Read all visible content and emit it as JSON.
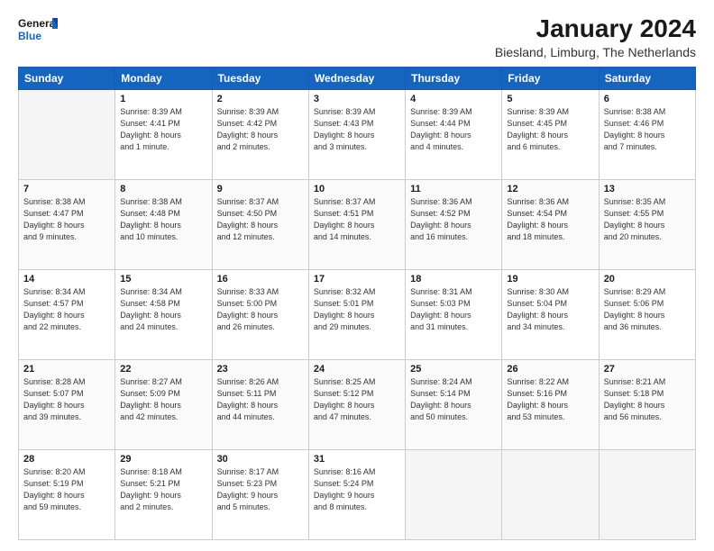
{
  "header": {
    "logo_general": "General",
    "logo_blue": "Blue",
    "month": "January 2024",
    "location": "Biesland, Limburg, The Netherlands"
  },
  "weekdays": [
    "Sunday",
    "Monday",
    "Tuesday",
    "Wednesday",
    "Thursday",
    "Friday",
    "Saturday"
  ],
  "weeks": [
    [
      {
        "day": "",
        "info": ""
      },
      {
        "day": "1",
        "info": "Sunrise: 8:39 AM\nSunset: 4:41 PM\nDaylight: 8 hours\nand 1 minute."
      },
      {
        "day": "2",
        "info": "Sunrise: 8:39 AM\nSunset: 4:42 PM\nDaylight: 8 hours\nand 2 minutes."
      },
      {
        "day": "3",
        "info": "Sunrise: 8:39 AM\nSunset: 4:43 PM\nDaylight: 8 hours\nand 3 minutes."
      },
      {
        "day": "4",
        "info": "Sunrise: 8:39 AM\nSunset: 4:44 PM\nDaylight: 8 hours\nand 4 minutes."
      },
      {
        "day": "5",
        "info": "Sunrise: 8:39 AM\nSunset: 4:45 PM\nDaylight: 8 hours\nand 6 minutes."
      },
      {
        "day": "6",
        "info": "Sunrise: 8:38 AM\nSunset: 4:46 PM\nDaylight: 8 hours\nand 7 minutes."
      }
    ],
    [
      {
        "day": "7",
        "info": "Sunrise: 8:38 AM\nSunset: 4:47 PM\nDaylight: 8 hours\nand 9 minutes."
      },
      {
        "day": "8",
        "info": "Sunrise: 8:38 AM\nSunset: 4:48 PM\nDaylight: 8 hours\nand 10 minutes."
      },
      {
        "day": "9",
        "info": "Sunrise: 8:37 AM\nSunset: 4:50 PM\nDaylight: 8 hours\nand 12 minutes."
      },
      {
        "day": "10",
        "info": "Sunrise: 8:37 AM\nSunset: 4:51 PM\nDaylight: 8 hours\nand 14 minutes."
      },
      {
        "day": "11",
        "info": "Sunrise: 8:36 AM\nSunset: 4:52 PM\nDaylight: 8 hours\nand 16 minutes."
      },
      {
        "day": "12",
        "info": "Sunrise: 8:36 AM\nSunset: 4:54 PM\nDaylight: 8 hours\nand 18 minutes."
      },
      {
        "day": "13",
        "info": "Sunrise: 8:35 AM\nSunset: 4:55 PM\nDaylight: 8 hours\nand 20 minutes."
      }
    ],
    [
      {
        "day": "14",
        "info": "Sunrise: 8:34 AM\nSunset: 4:57 PM\nDaylight: 8 hours\nand 22 minutes."
      },
      {
        "day": "15",
        "info": "Sunrise: 8:34 AM\nSunset: 4:58 PM\nDaylight: 8 hours\nand 24 minutes."
      },
      {
        "day": "16",
        "info": "Sunrise: 8:33 AM\nSunset: 5:00 PM\nDaylight: 8 hours\nand 26 minutes."
      },
      {
        "day": "17",
        "info": "Sunrise: 8:32 AM\nSunset: 5:01 PM\nDaylight: 8 hours\nand 29 minutes."
      },
      {
        "day": "18",
        "info": "Sunrise: 8:31 AM\nSunset: 5:03 PM\nDaylight: 8 hours\nand 31 minutes."
      },
      {
        "day": "19",
        "info": "Sunrise: 8:30 AM\nSunset: 5:04 PM\nDaylight: 8 hours\nand 34 minutes."
      },
      {
        "day": "20",
        "info": "Sunrise: 8:29 AM\nSunset: 5:06 PM\nDaylight: 8 hours\nand 36 minutes."
      }
    ],
    [
      {
        "day": "21",
        "info": "Sunrise: 8:28 AM\nSunset: 5:07 PM\nDaylight: 8 hours\nand 39 minutes."
      },
      {
        "day": "22",
        "info": "Sunrise: 8:27 AM\nSunset: 5:09 PM\nDaylight: 8 hours\nand 42 minutes."
      },
      {
        "day": "23",
        "info": "Sunrise: 8:26 AM\nSunset: 5:11 PM\nDaylight: 8 hours\nand 44 minutes."
      },
      {
        "day": "24",
        "info": "Sunrise: 8:25 AM\nSunset: 5:12 PM\nDaylight: 8 hours\nand 47 minutes."
      },
      {
        "day": "25",
        "info": "Sunrise: 8:24 AM\nSunset: 5:14 PM\nDaylight: 8 hours\nand 50 minutes."
      },
      {
        "day": "26",
        "info": "Sunrise: 8:22 AM\nSunset: 5:16 PM\nDaylight: 8 hours\nand 53 minutes."
      },
      {
        "day": "27",
        "info": "Sunrise: 8:21 AM\nSunset: 5:18 PM\nDaylight: 8 hours\nand 56 minutes."
      }
    ],
    [
      {
        "day": "28",
        "info": "Sunrise: 8:20 AM\nSunset: 5:19 PM\nDaylight: 8 hours\nand 59 minutes."
      },
      {
        "day": "29",
        "info": "Sunrise: 8:18 AM\nSunset: 5:21 PM\nDaylight: 9 hours\nand 2 minutes."
      },
      {
        "day": "30",
        "info": "Sunrise: 8:17 AM\nSunset: 5:23 PM\nDaylight: 9 hours\nand 5 minutes."
      },
      {
        "day": "31",
        "info": "Sunrise: 8:16 AM\nSunset: 5:24 PM\nDaylight: 9 hours\nand 8 minutes."
      },
      {
        "day": "",
        "info": ""
      },
      {
        "day": "",
        "info": ""
      },
      {
        "day": "",
        "info": ""
      }
    ]
  ]
}
